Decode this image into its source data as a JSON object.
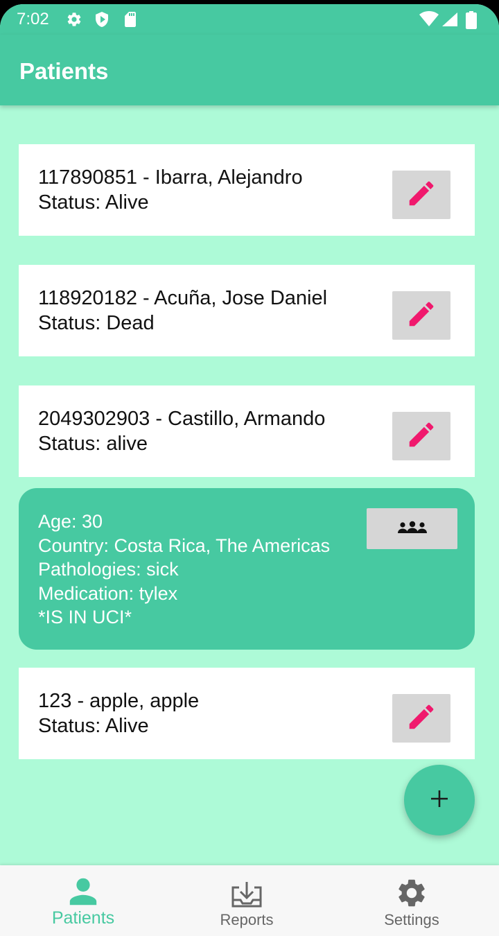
{
  "status_bar": {
    "time": "7:02",
    "icons": [
      "gear-icon",
      "shield-icon",
      "sd-card-icon",
      "wifi-icon",
      "signal-icon",
      "battery-icon"
    ]
  },
  "app_bar": {
    "title": "Patients"
  },
  "patients": [
    {
      "title": "117890851 - Ibarra, Alejandro",
      "status": "Status: Alive"
    },
    {
      "title": "118920182 - Acuña, Jose Daniel",
      "status": "Status: Dead"
    },
    {
      "title": "2049302903 - Castillo, Armando",
      "status": "Status: alive"
    },
    {
      "title": "123 - apple, apple",
      "status": "Status: Alive"
    }
  ],
  "detail": {
    "age": "Age: 30",
    "country": "Country: Costa Rica, The Americas",
    "pathologies": "Pathologies: sick",
    "medication": "Medication: tylex",
    "flag": "*IS IN UCI*"
  },
  "fab": {
    "icon": "plus-icon"
  },
  "bottom_nav": {
    "items": [
      {
        "label": "Patients",
        "icon": "person-icon",
        "active": true
      },
      {
        "label": "Reports",
        "icon": "download-tray-icon",
        "active": false
      },
      {
        "label": "Settings",
        "icon": "gear-icon",
        "active": false
      }
    ]
  },
  "colors": {
    "primary": "#47c9a1",
    "background": "#adfad7",
    "accent_pink": "#f0196d",
    "button_gray": "#d6d6d6",
    "nav_inactive": "#666666"
  }
}
